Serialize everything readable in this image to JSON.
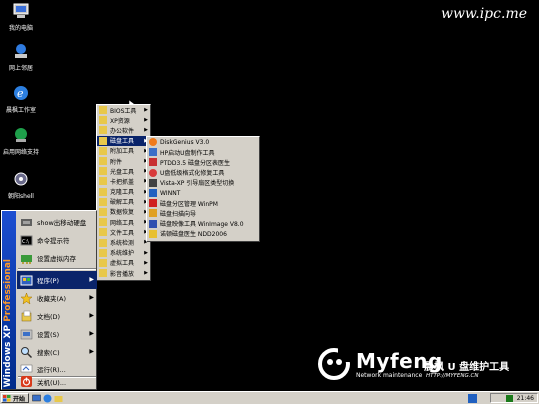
{
  "watermark": "www.ipc.me",
  "desktop_icons": [
    {
      "label": "我的电脑",
      "icon": "my-computer-icon"
    },
    {
      "label": "网上邻居",
      "icon": "network-icon"
    },
    {
      "label": "晨枫工作室",
      "icon": "ie-icon"
    },
    {
      "label": "启用网络支持",
      "icon": "network-support-icon"
    },
    {
      "label": "朝阳shell",
      "icon": "shell-icon"
    }
  ],
  "start_menu": {
    "sidebar_text_a": "Windows XP ",
    "sidebar_text_b": "Professional",
    "pinned": [
      {
        "label": "show出移动硬盘"
      },
      {
        "label": "命令提示符"
      },
      {
        "label": "设置虚拟内存"
      }
    ],
    "items": [
      {
        "label": "程序(P)"
      },
      {
        "label": "收藏夹(A)"
      },
      {
        "label": "文档(D)"
      },
      {
        "label": "设置(S)"
      },
      {
        "label": "搜索(C)"
      },
      {
        "label": "运行(R)..."
      },
      {
        "label": "关机(U)..."
      }
    ]
  },
  "programs_menu": [
    {
      "label": "BIOS工具"
    },
    {
      "label": "XP资源"
    },
    {
      "label": "办公软件"
    },
    {
      "label": "磁盘工具"
    },
    {
      "label": "附加工具"
    },
    {
      "label": "附件"
    },
    {
      "label": "光盘工具"
    },
    {
      "label": "卡把抓盖"
    },
    {
      "label": "克隆工具"
    },
    {
      "label": "破解工具"
    },
    {
      "label": "数据恢复"
    },
    {
      "label": "网络工具"
    },
    {
      "label": "文件工具"
    },
    {
      "label": "系统检测"
    },
    {
      "label": "系统维护"
    },
    {
      "label": "虚拟工具"
    },
    {
      "label": "影音播放"
    }
  ],
  "disk_tools_menu": [
    {
      "label": "DiskGenius V3.0",
      "icon": "diskgenius-icon"
    },
    {
      "label": "HP启动U盘制作工具",
      "icon": "hp-usb-icon"
    },
    {
      "label": "PTDD3.5 磁盘分区表医生",
      "icon": "ptdd-icon"
    },
    {
      "label": "U盘低级格式化修复工具",
      "icon": "usb-format-icon"
    },
    {
      "label": "Vista-XP 引导扇区类型切换",
      "icon": "boot-switch-icon"
    },
    {
      "label": "WINNT",
      "icon": "winnt-icon"
    },
    {
      "label": "磁盘分区管理 WinPM",
      "icon": "winpm-icon"
    },
    {
      "label": "磁盘扫描向导",
      "icon": "disk-scan-icon"
    },
    {
      "label": "磁盘映像工具 WinImage V8.0",
      "icon": "winimage-icon"
    },
    {
      "label": "诺顿磁盘医生 NDD2006",
      "icon": "ndd-icon"
    }
  ],
  "taskbar": {
    "start_label": "开始",
    "clock": "21:46"
  },
  "logo": {
    "brand": "Myfeng",
    "sub": "Network maintenance",
    "cn": "晨枫 U 盘维护工具",
    "url": "HTTP://MYFENG.CN"
  },
  "colors": {
    "desktop": "#000000",
    "menu_bg": "#d4d0c8",
    "highlight": "#0a246a",
    "sidebar": "#1c4ed1"
  }
}
